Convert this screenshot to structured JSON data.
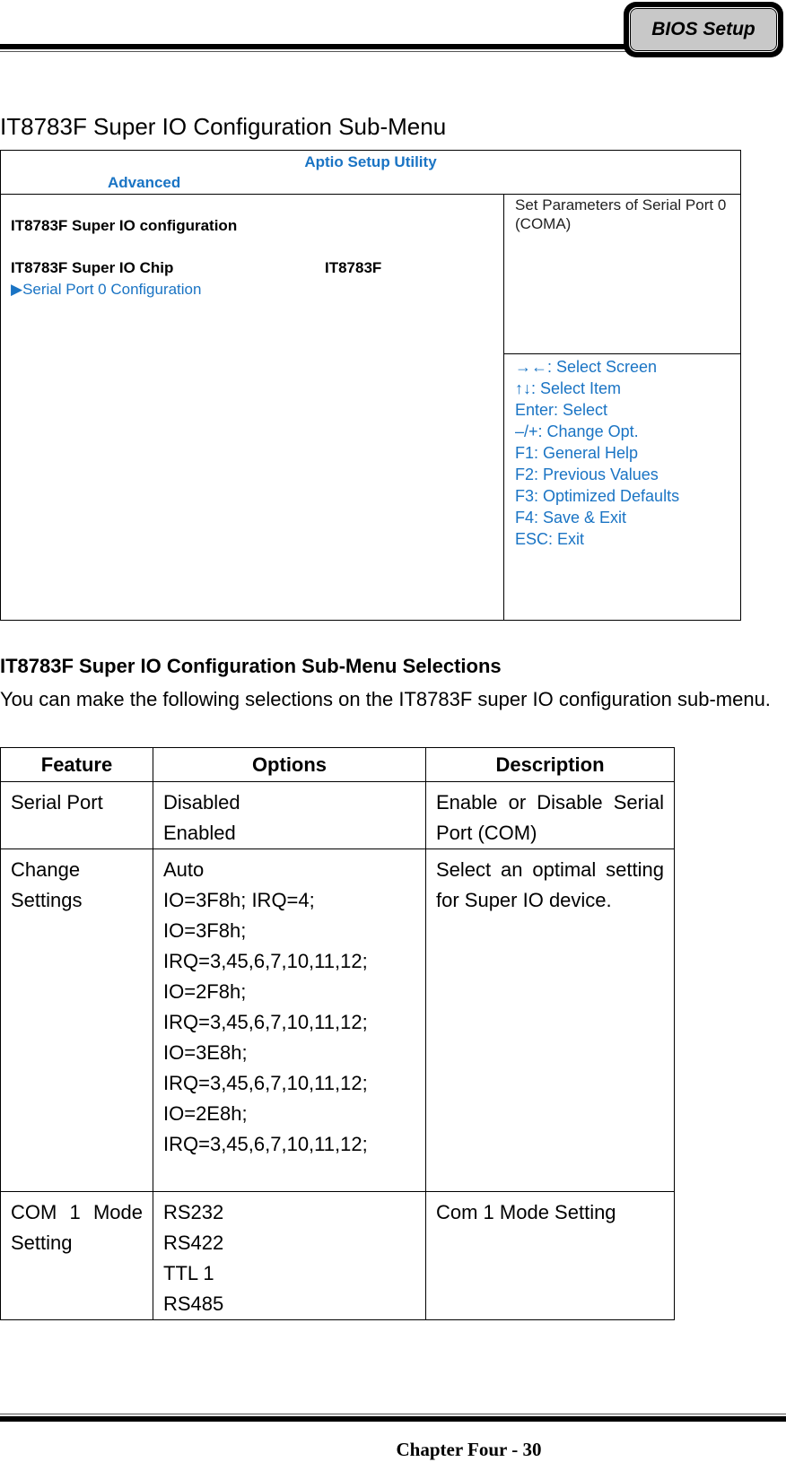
{
  "header": {
    "section_tab": "BIOS Setup"
  },
  "page_title": "IT8783F Super IO Configuration Sub-Menu",
  "bios_screen": {
    "utility_title": "Aptio Setup Utility",
    "active_tab": "Advanced",
    "section_title": "IT8783F Super IO configuration",
    "chip_label": "IT8783F Super IO Chip",
    "chip_value": "IT8783F",
    "submenu_arrow_icon": "▶",
    "submenu_item": "Serial Port 0 Configuration",
    "help_text": "Set Parameters of Serial Port 0 (COMA)",
    "key_legend": [
      "→←: Select Screen",
      "↑↓: Select Item",
      "Enter: Select",
      "–/+: Change Opt.",
      "F1: General Help",
      "F2: Previous Values",
      "F3: Optimized Defaults",
      "F4: Save & Exit",
      "ESC: Exit"
    ],
    "accent_color": "#1a74c4"
  },
  "selections": {
    "title": "IT8783F Super IO Configuration Sub-Menu Selections",
    "intro": "You can make the following selections on the IT8783F super IO configuration sub-menu.",
    "table": {
      "headers": [
        "Feature",
        "Options",
        "Description"
      ],
      "rows": [
        {
          "feature": "Serial Port",
          "options": [
            "Disabled",
            "Enabled"
          ],
          "description": "Enable or Disable Serial Port (COM)"
        },
        {
          "feature": "Change Settings",
          "options": [
            "Auto",
            "IO=3F8h; IRQ=4;",
            "IO=3F8h;",
            "IRQ=3,45,6,7,10,11,12;",
            "IO=2F8h;",
            "IRQ=3,45,6,7,10,11,12;",
            "IO=3E8h;",
            "IRQ=3,45,6,7,10,11,12;",
            "IO=2E8h;",
            "IRQ=3,45,6,7,10,11,12;"
          ],
          "description": "Select an optimal setting for Super IO device."
        },
        {
          "feature": "COM 1 Mode Setting",
          "options": [
            "RS232",
            "RS422",
            "TTL 1",
            "RS485"
          ],
          "description": "Com 1 Mode Setting"
        }
      ]
    }
  },
  "footer": {
    "page_label": "Chapter Four - 30"
  }
}
